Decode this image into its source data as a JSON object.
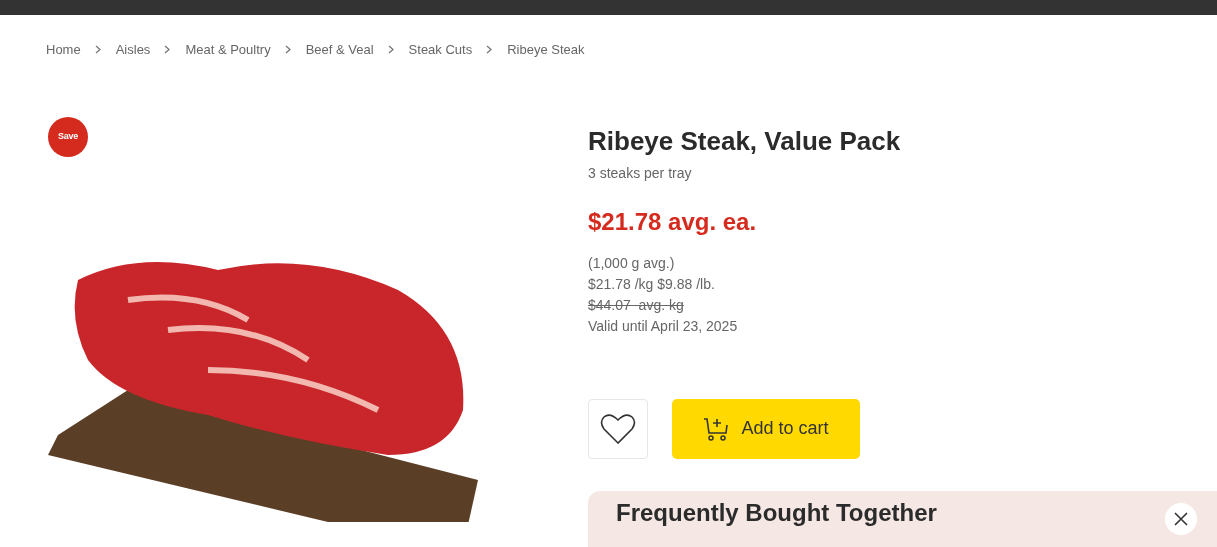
{
  "breadcrumb": [
    {
      "label": "Home"
    },
    {
      "label": "Aisles"
    },
    {
      "label": "Meat & Poultry"
    },
    {
      "label": "Beef & Veal"
    },
    {
      "label": "Steak Cuts"
    },
    {
      "label": "Ribeye Steak"
    }
  ],
  "badge": {
    "label": "Save"
  },
  "product": {
    "title": "Ribeye Steak, Value Pack",
    "subtitle": "3 steaks per tray",
    "price": "$21.78 avg. ea.",
    "details": [
      {
        "text": "(1,000 g avg.)",
        "struck": false
      },
      {
        "text": "$21.78 /kg $9.88 /lb.",
        "struck": false
      },
      {
        "text": "$44.07  avg. kg",
        "struck": true
      },
      {
        "text": "Valid until April 23, 2025",
        "struck": false
      }
    ]
  },
  "actions": {
    "add_to_cart": "Add to cart"
  },
  "panel": {
    "title": "Frequently Bought Together"
  }
}
